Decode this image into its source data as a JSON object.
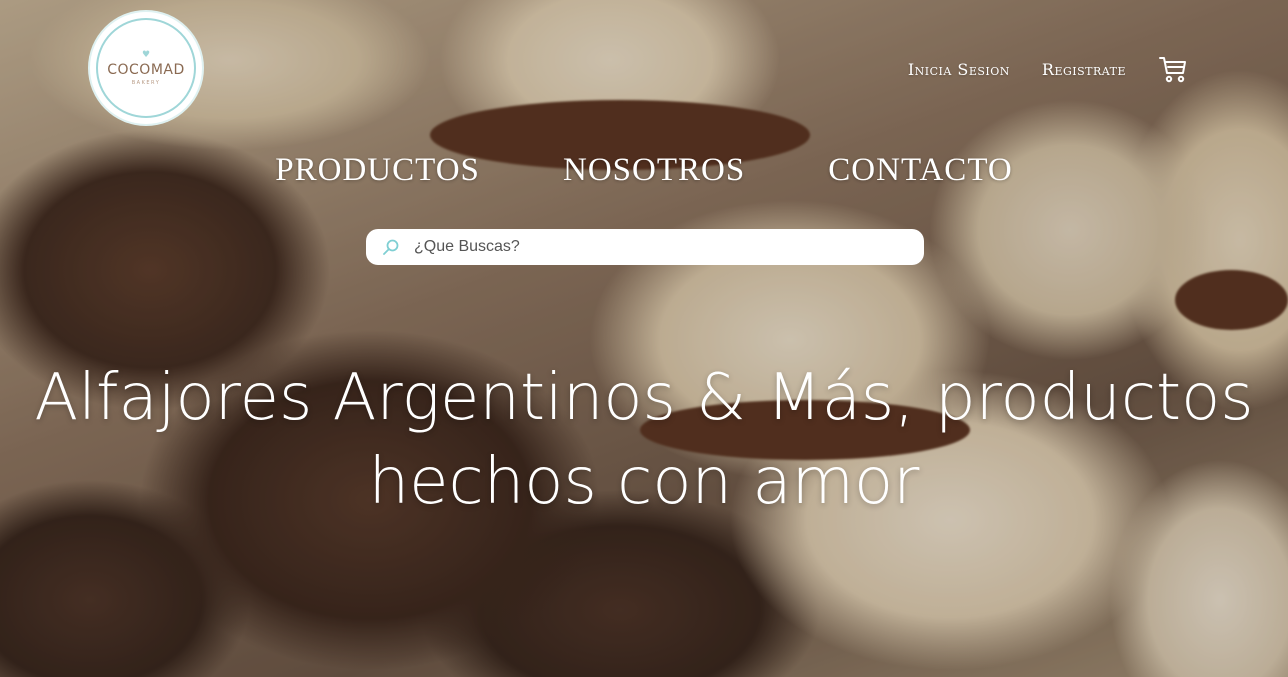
{
  "logo": {
    "name": "COCOMAD",
    "subtitle": "BAKERY"
  },
  "account": {
    "login_label": "Inicia Sesion",
    "register_label": "Registrate",
    "cart_icon": "cart-icon"
  },
  "nav": {
    "items": [
      {
        "label": "PRODUCTOS"
      },
      {
        "label": "NOSOTROS"
      },
      {
        "label": "CONTACTO"
      }
    ]
  },
  "search": {
    "placeholder": "¿Que Buscas?",
    "icon": "search-icon"
  },
  "hero": {
    "line1": "Alfajores Argentinos & Más, productos",
    "line2": "hechos con amor"
  },
  "colors": {
    "accent": "#9fd6d8",
    "logo_text": "#8a6a52",
    "text_on_image": "#ffffff"
  }
}
